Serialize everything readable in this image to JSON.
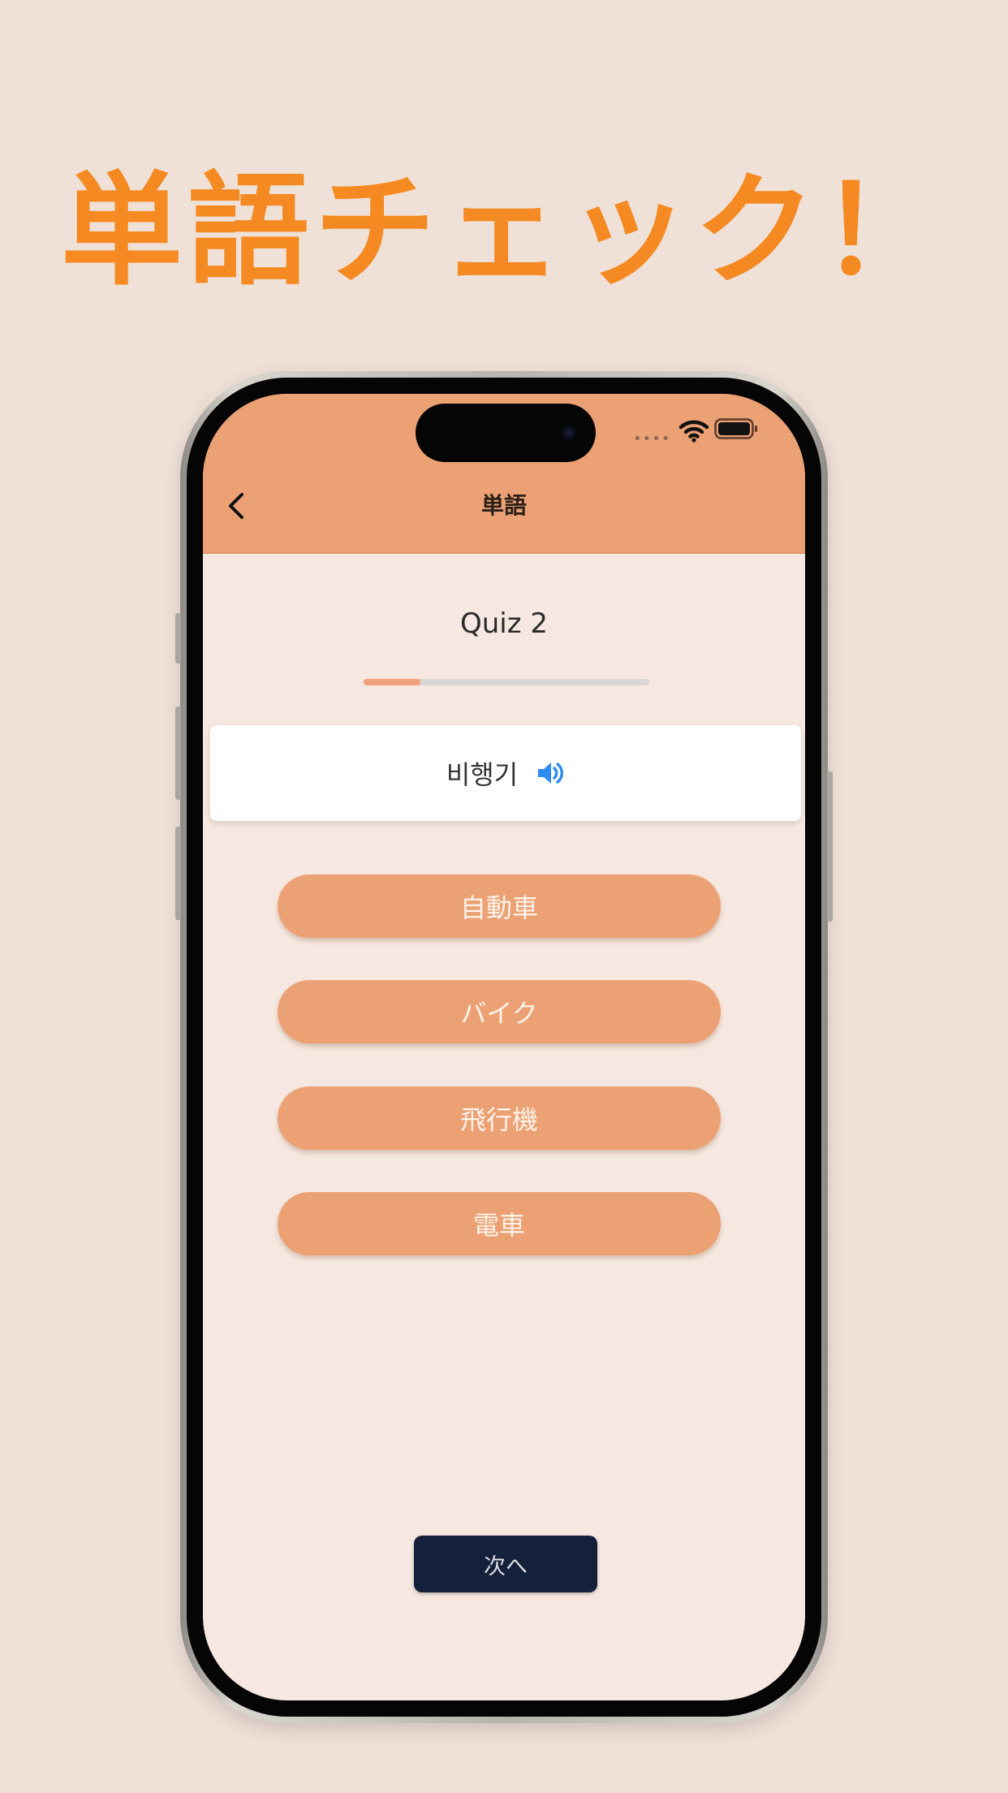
{
  "promo": {
    "headline": "単語チェック！"
  },
  "status_bar": {
    "dots": "••••"
  },
  "header": {
    "title": "単語"
  },
  "quiz": {
    "title": "Quiz 2",
    "progress": 0.2,
    "word": "비행기"
  },
  "options": [
    {
      "label": "自動車"
    },
    {
      "label": "バイク"
    },
    {
      "label": "飛行機"
    },
    {
      "label": "電車"
    }
  ],
  "footer": {
    "next_label": "次へ"
  },
  "colors": {
    "background": "#f0e1d8",
    "headline": "#f48a21",
    "header": "#eca174",
    "option": "#eca174",
    "screen": "#f6e8e0",
    "next_button": "#15213a",
    "speaker": "#2e8cf0"
  },
  "icons": {
    "back": "chevron-left-icon",
    "speaker": "speaker-icon",
    "wifi": "wifi-icon",
    "battery": "battery-icon"
  }
}
